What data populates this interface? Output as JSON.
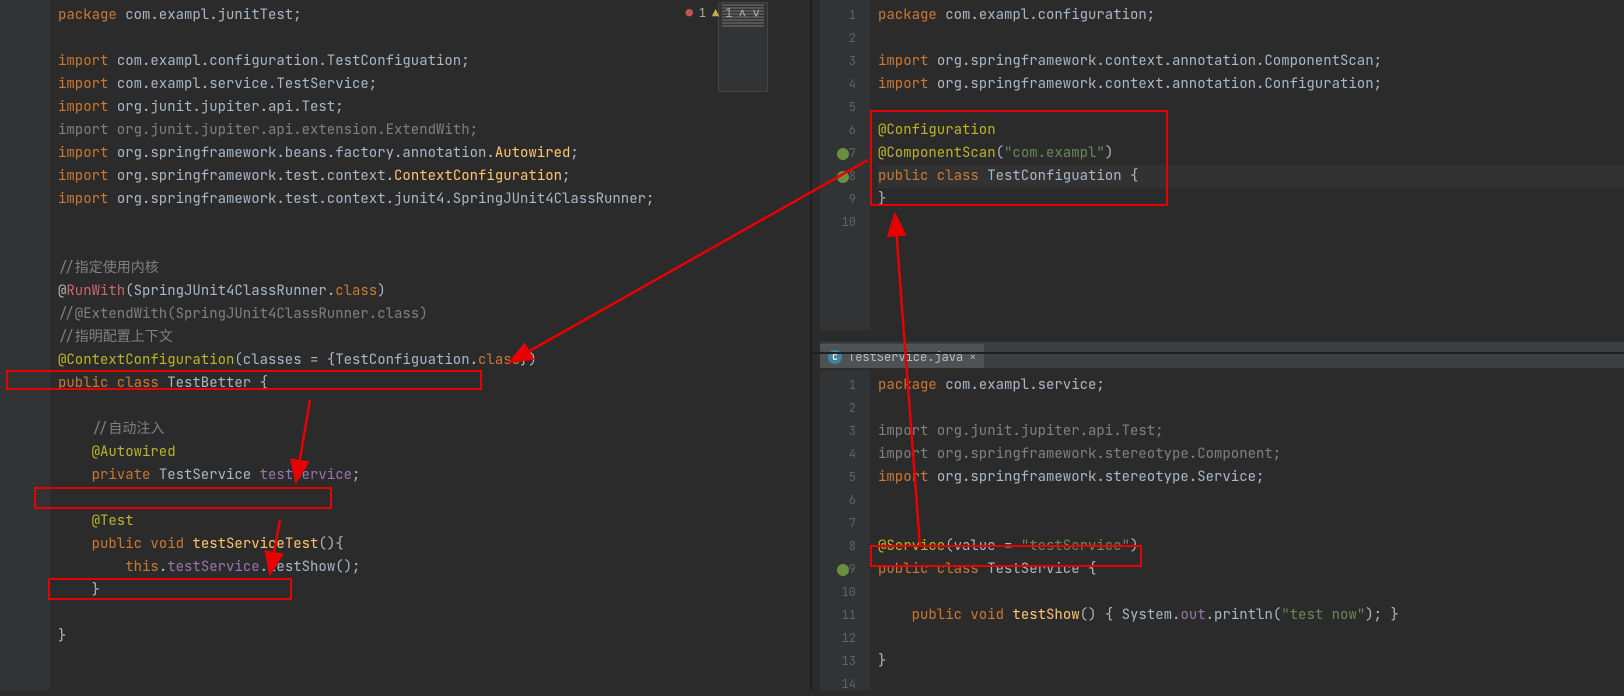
{
  "problems": {
    "errors": "1",
    "warnings": "1"
  },
  "left": {
    "lines": [
      [
        [
          "kw",
          "package "
        ],
        [
          "pkg",
          "com.exampl.junitTest;"
        ]
      ],
      [
        [
          "",
          ""
        ]
      ],
      [
        [
          "kw",
          "import "
        ],
        [
          "pkg",
          "com.exampl.configuration.TestConfiguation;"
        ]
      ],
      [
        [
          "kw",
          "import "
        ],
        [
          "pkg",
          "com.exampl.service.TestService;"
        ]
      ],
      [
        [
          "kw",
          "import "
        ],
        [
          "pkg",
          "org.junit.jupiter.api.Test;"
        ]
      ],
      [
        [
          "mut",
          "import org.junit.jupiter.api.extension.ExtendWith;"
        ]
      ],
      [
        [
          "kw",
          "import "
        ],
        [
          "pkg",
          "org.springframework.beans.factory.annotation."
        ],
        [
          "cls2",
          "Autowired"
        ],
        [
          "white",
          ";"
        ]
      ],
      [
        [
          "kw",
          "import "
        ],
        [
          "pkg",
          "org.springframework.test.context."
        ],
        [
          "cls2",
          "ContextConfiguration"
        ],
        [
          "white",
          ";"
        ]
      ],
      [
        [
          "kw",
          "import "
        ],
        [
          "pkg",
          "org.springframework.test.context.junit4.SpringJUnit4ClassRunner;"
        ]
      ],
      [
        [
          "",
          ""
        ]
      ],
      [
        [
          "",
          ""
        ]
      ],
      [
        [
          "cmt",
          "//指定使用内核"
        ]
      ],
      [
        [
          "white",
          "@"
        ],
        [
          "err",
          "RunWith"
        ],
        [
          "white",
          "(SpringJUnit4ClassRunner."
        ],
        [
          "kw",
          "class"
        ],
        [
          "white",
          ")"
        ]
      ],
      [
        [
          "cmt",
          "//@ExtendWith(SpringJUnit4ClassRunner.class)"
        ]
      ],
      [
        [
          "cmt",
          "//指明配置上下文"
        ]
      ],
      [
        [
          "ann",
          "@ContextConfiguration"
        ],
        [
          "white",
          "(classes = {TestConfiguation."
        ],
        [
          "kw",
          "class"
        ],
        [
          "white",
          "})"
        ]
      ],
      [
        [
          "kw",
          "public class "
        ],
        [
          "white",
          "TestBetter {"
        ]
      ],
      [
        [
          "",
          ""
        ]
      ],
      [
        [
          "white",
          "    "
        ],
        [
          "cmt",
          "//自动注入"
        ]
      ],
      [
        [
          "white",
          "    "
        ],
        [
          "ann",
          "@Autowired"
        ]
      ],
      [
        [
          "white",
          "    "
        ],
        [
          "kw",
          "private "
        ],
        [
          "white",
          "TestService "
        ],
        [
          "fld",
          "testService"
        ],
        [
          "white",
          ";"
        ]
      ],
      [
        [
          "",
          ""
        ]
      ],
      [
        [
          "white",
          "    "
        ],
        [
          "ann",
          "@Test"
        ]
      ],
      [
        [
          "white",
          "    "
        ],
        [
          "kw",
          "public void "
        ],
        [
          "cls2",
          "testServiceTest"
        ],
        [
          "white",
          "(){"
        ]
      ],
      [
        [
          "white",
          "        "
        ],
        [
          "kw",
          "this"
        ],
        [
          "white",
          "."
        ],
        [
          "fld",
          "testService"
        ],
        [
          "white",
          ".testShow();"
        ]
      ],
      [
        [
          "white",
          "    }"
        ]
      ],
      [
        [
          "",
          ""
        ]
      ],
      [
        [
          "white",
          "}"
        ]
      ]
    ]
  },
  "rightTop": {
    "lineNumbers": [
      "1",
      "2",
      "3",
      "4",
      "5",
      "6",
      "7",
      "8",
      "9",
      "10"
    ],
    "lines": [
      [
        [
          "kw",
          "package "
        ],
        [
          "pkg",
          "com.exampl.configuration;"
        ]
      ],
      [
        [
          "",
          ""
        ]
      ],
      [
        [
          "kw",
          "import "
        ],
        [
          "pkg",
          "org.springframework.context.annotation.ComponentScan;"
        ]
      ],
      [
        [
          "kw",
          "import "
        ],
        [
          "pkg",
          "org.springframework.context.annotation.Configuration;"
        ]
      ],
      [
        [
          "",
          ""
        ]
      ],
      [
        [
          "ann",
          "@Configuration"
        ]
      ],
      [
        [
          "ann",
          "@ComponentScan"
        ],
        [
          "white",
          "("
        ],
        [
          "str",
          "\"com.exampl\""
        ],
        [
          "white",
          ")"
        ]
      ],
      [
        [
          "kw",
          "public class "
        ],
        [
          "white",
          "TestConfiguation {"
        ]
      ],
      [
        [
          "white",
          "}"
        ]
      ],
      [
        [
          "",
          ""
        ]
      ]
    ]
  },
  "rightBottom": {
    "tab": "TestService.java",
    "lineNumbers": [
      "1",
      "2",
      "3",
      "4",
      "5",
      "6",
      "7",
      "8",
      "9",
      "10",
      "11",
      "12",
      "13",
      "14"
    ],
    "lines": [
      [
        [
          "kw",
          "package "
        ],
        [
          "pkg",
          "com.exampl.service;"
        ]
      ],
      [
        [
          "",
          ""
        ]
      ],
      [
        [
          "mut",
          "import org.junit.jupiter.api.Test;"
        ]
      ],
      [
        [
          "mut",
          "import org.springframework.stereotype.Component;"
        ]
      ],
      [
        [
          "kw",
          "import "
        ],
        [
          "pkg",
          "org.springframework.stereotype.Service;"
        ]
      ],
      [
        [
          "",
          ""
        ]
      ],
      [
        [
          "",
          ""
        ]
      ],
      [
        [
          "ann",
          "@Service"
        ],
        [
          "white",
          "(value = "
        ],
        [
          "str",
          "\"testService\""
        ],
        [
          "white",
          ")"
        ]
      ],
      [
        [
          "kw",
          "public class "
        ],
        [
          "white",
          "TestService {"
        ]
      ],
      [
        [
          "",
          ""
        ]
      ],
      [
        [
          "white",
          "    "
        ],
        [
          "kw",
          "public void "
        ],
        [
          "cls2",
          "testShow"
        ],
        [
          "white",
          "() { System."
        ],
        [
          "fld",
          "out"
        ],
        [
          "white",
          ".println("
        ],
        [
          "str",
          "\"test now\""
        ],
        [
          "white",
          "); }"
        ]
      ],
      [
        [
          "",
          ""
        ]
      ],
      [
        [
          "white",
          "}"
        ]
      ],
      [
        [
          "",
          ""
        ]
      ]
    ]
  }
}
